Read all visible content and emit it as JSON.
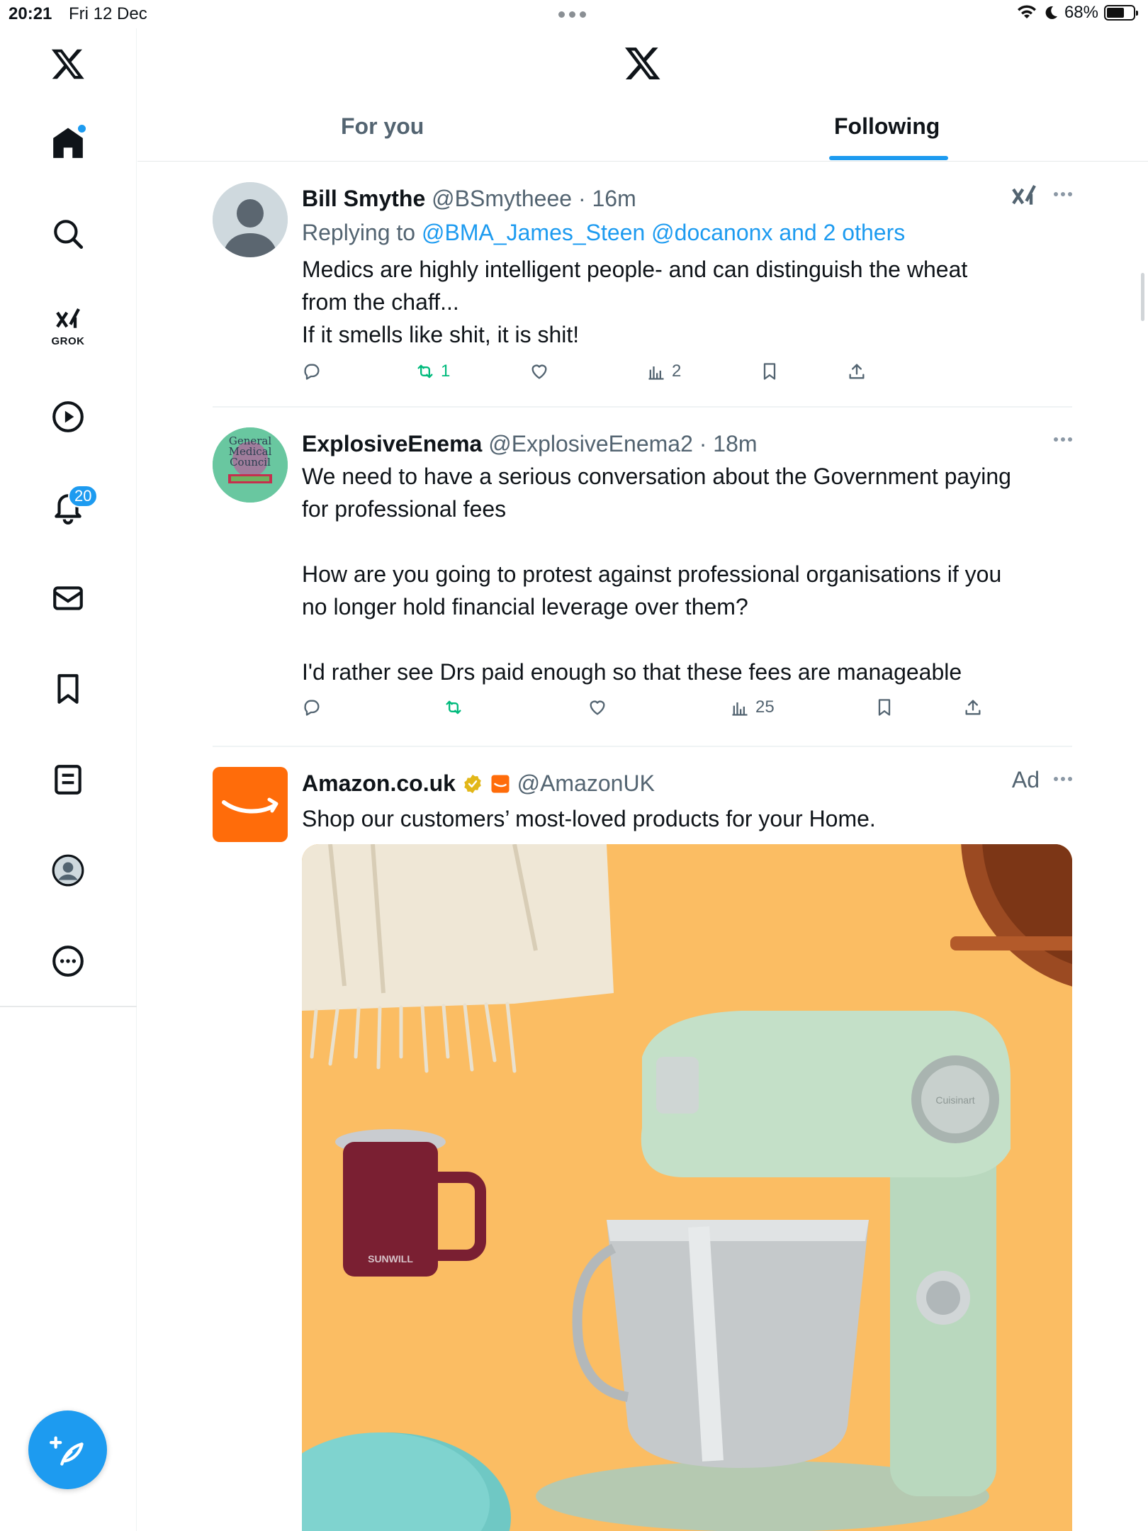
{
  "status_bar": {
    "time": "20:21",
    "date": "Fri 12 Dec",
    "battery": "68%",
    "battery_level": 0.68
  },
  "sidebar": {
    "grok_label": "GROK",
    "notifications_count": "20",
    "items": [
      "home-icon",
      "search-icon",
      "grok-icon",
      "video-icon",
      "bell-icon",
      "mail-icon",
      "bookmark-icon",
      "list-icon",
      "profile-icon",
      "more-icon"
    ]
  },
  "tabs": {
    "for_you": "For you",
    "following": "Following",
    "active": "Following"
  },
  "tweets": [
    {
      "name": "Bill Smythe",
      "handle": "@BSmytheee",
      "time": "· 16m",
      "replying_prefix": "Replying to",
      "replying_to": "@BMA_James_Steen @docanonx and 2 others",
      "text": [
        "Medics are highly intelligent people- and can distinguish the wheat",
        "from the chaff...",
        "If it smells like shit, it is shit!"
      ],
      "retweets": "1",
      "views": "2"
    },
    {
      "name": "ExplosiveEnema",
      "handle": "@ExplosiveEnema2",
      "time": "· 18m",
      "avatar_text": [
        "General",
        "Medical",
        "Council"
      ],
      "text": [
        "We need to have a serious conversation about the Government paying",
        "for professional fees",
        "",
        "How are you going to protest against professional organisations if you",
        "no longer hold financial leverage over them?",
        "",
        "I'd rather see Drs paid enough so that these fees are manageable"
      ],
      "views": "25"
    },
    {
      "name": "Amazon.co.uk",
      "handle": "@AmazonUK",
      "ad_label": "Ad",
      "text": [
        "Shop our customers’ most-loved products for your Home."
      ],
      "mug_brand": "SUNWILL",
      "mixer_brand": "Cuisinart"
    }
  ],
  "colors": {
    "accent": "#1d9bf0",
    "retweet": "#00ba7c",
    "secondary": "#536471",
    "amazon": "#ff6c0a",
    "ad_background": "#fbbd63"
  }
}
